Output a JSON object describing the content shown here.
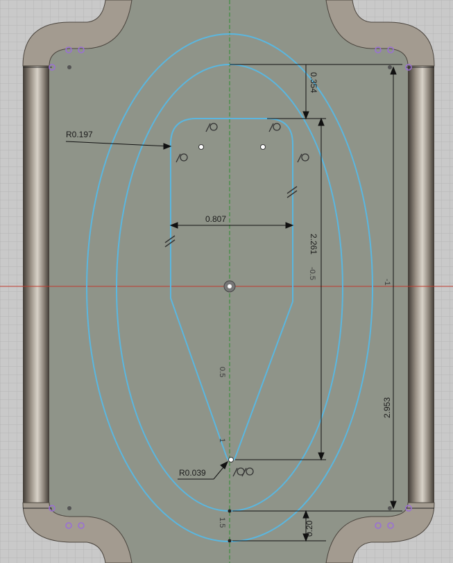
{
  "dimensions": {
    "radius_top_left": "R0.197",
    "width_inner": "0.807",
    "top_offset": "0.354",
    "slot_height": "2.261",
    "total_height": "2.953",
    "radius_bottom": "R0.039",
    "bottom_offset": "0.20"
  },
  "axis_labels": {
    "y_neg_half": "-0.5",
    "y_neg_one": "-1",
    "y_half": "0.5",
    "y_one": "1",
    "y_one_half": "1.5"
  },
  "colors": {
    "background_grid": "#c9c9c9",
    "plate": "#8f9489",
    "sketch_line": "#5ab7e0",
    "x_axis": "#c0392b",
    "y_axis": "#2e8b2e",
    "constraint_point": "#9a6fd6"
  },
  "icons": {
    "tangent_constraint": "tangent-constraint-icon",
    "parallel_constraint": "parallel-constraint-icon",
    "origin": "origin-icon"
  }
}
